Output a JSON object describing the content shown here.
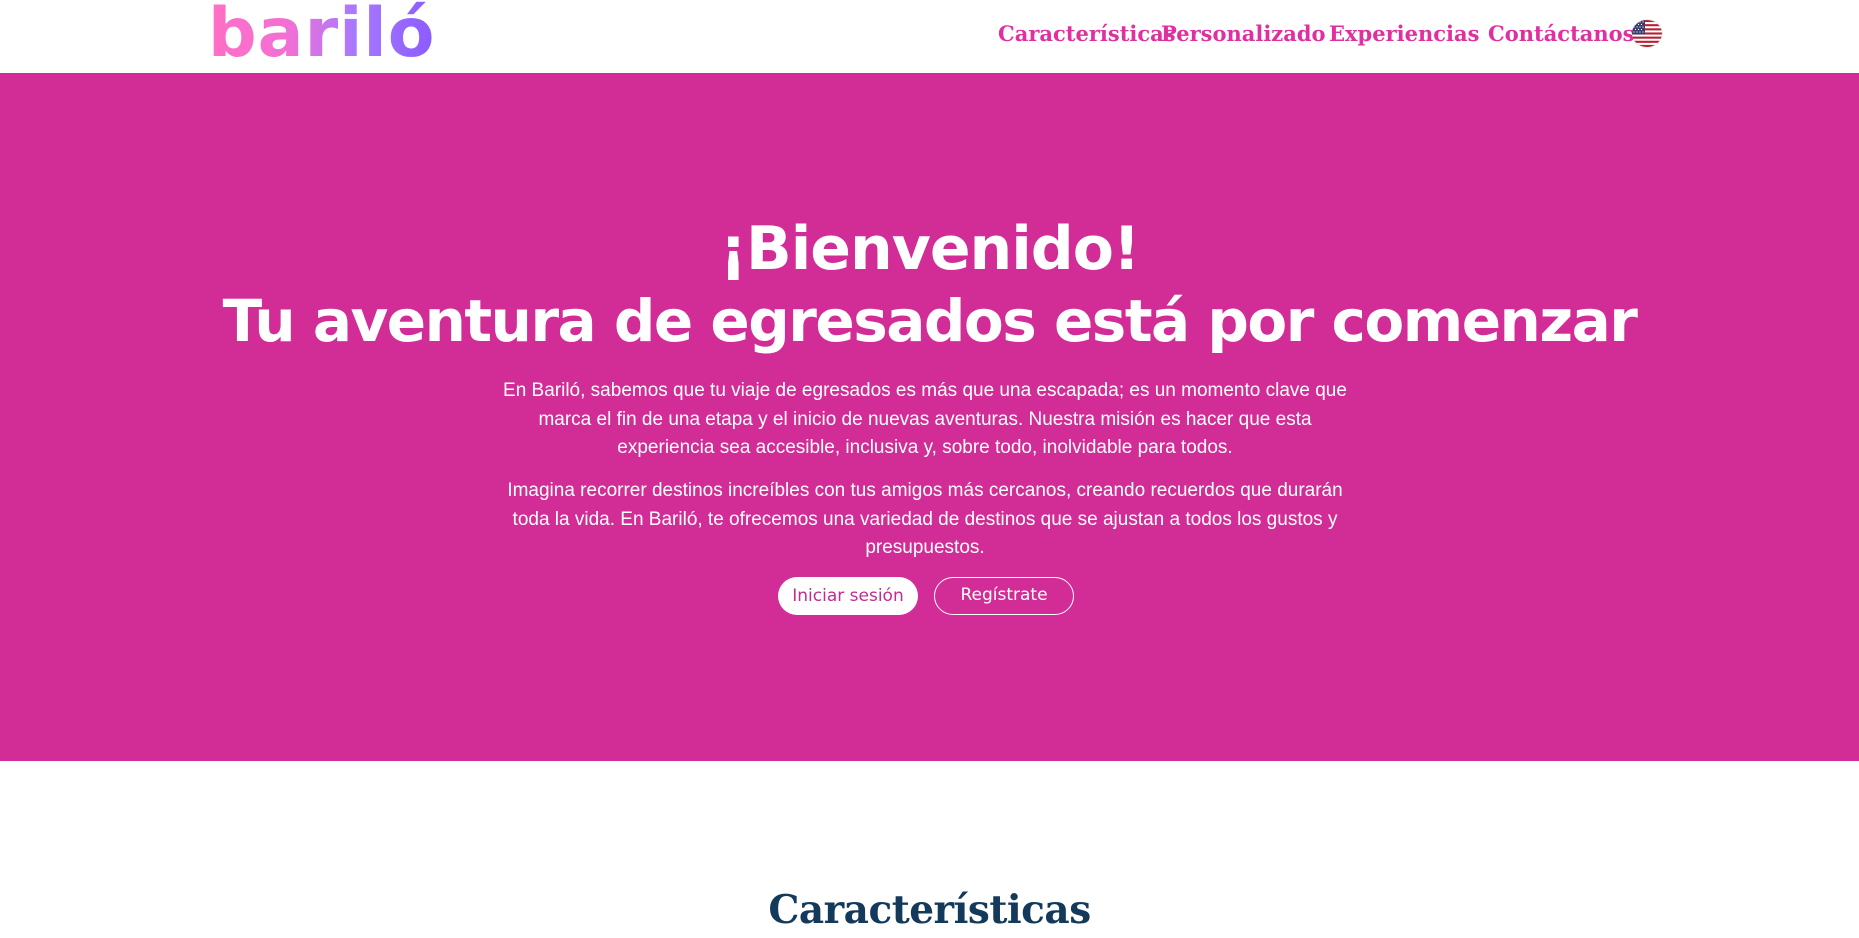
{
  "brand": {
    "logo_text": "bariló",
    "logo_gradient": [
      "#ff6fc4",
      "#f36fd5",
      "#a779ff",
      "#8b5bff"
    ]
  },
  "nav": {
    "items": [
      {
        "label": "Características"
      },
      {
        "label": "Personalizado"
      },
      {
        "label": "Experiencias"
      },
      {
        "label": "Contáctanos"
      }
    ],
    "language_icon": "us-flag-icon",
    "link_color": "#e02f9f"
  },
  "hero": {
    "background": "#d22c97",
    "title_line1": "¡Bienvenido!",
    "title_line2": "Tu aventura de egresados está por comenzar",
    "paragraph1": "En Bariló, sabemos que tu viaje de egresados es más que una escapada; es un momento clave que marca el fin de una etapa y el inicio de nuevas aventuras. Nuestra misión es hacer que esta experiencia sea accesible, inclusiva y, sobre todo, inolvidable para todos.",
    "paragraph2": "Imagina recorrer destinos increíbles con tus amigos más cercanos, creando recuerdos que durarán toda la vida. En Bariló, te ofrecemos una variedad de destinos que se ajustan a todos los gustos y presupuestos.",
    "login_label": "Iniciar sesión",
    "register_label": "Regístrate"
  },
  "features": {
    "title": "Características",
    "title_color": "#133a5a"
  }
}
